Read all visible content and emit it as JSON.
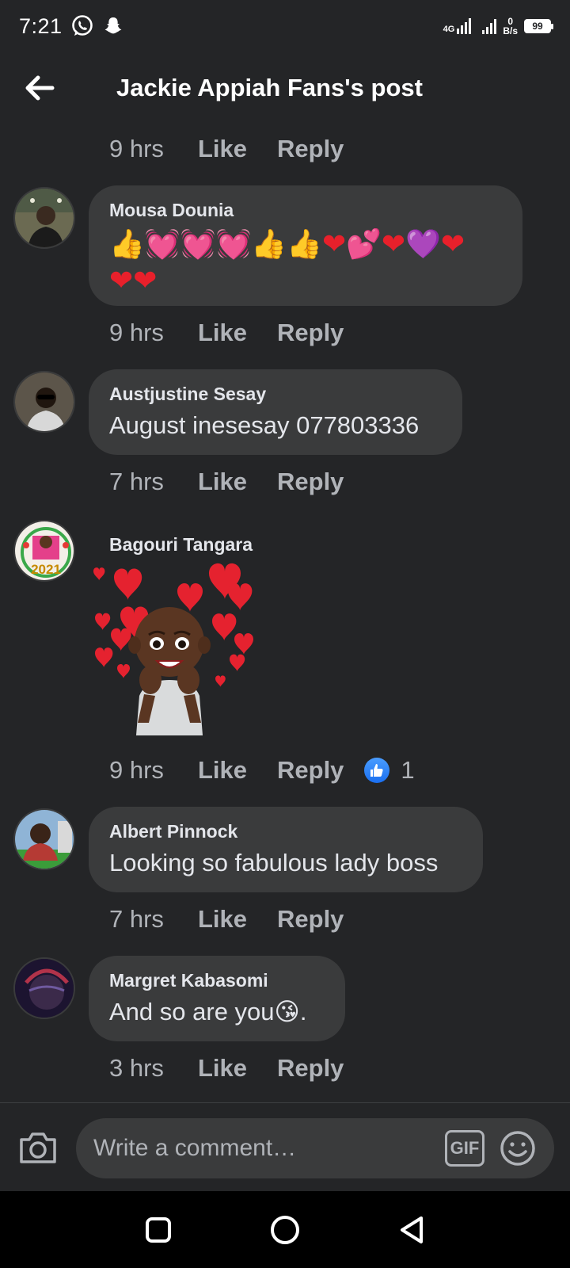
{
  "status_bar": {
    "time": "7:21",
    "network_tag": "4G",
    "speed_value": "0",
    "speed_unit": "B/s",
    "battery": "99"
  },
  "header": {
    "title": "Jackie Appiah Fans's post"
  },
  "actions": {
    "like": "Like",
    "reply": "Reply"
  },
  "top_meta": {
    "time": "9 hrs"
  },
  "comments": [
    {
      "author": "Mousa Dounia",
      "emoji_line_1": "👍💓💓💓👍👍❤💕❤💜❤",
      "emoji_line_2": "❤❤",
      "time": "9 hrs"
    },
    {
      "author": "Austjustine Sesay",
      "text": "August inesesay 077803336",
      "time": "7 hrs"
    },
    {
      "author": "Bagouri Tangara",
      "avatar_text": "2021",
      "sticker": "heart-eyes-avatar-sticker",
      "time": "9 hrs",
      "reaction_count": "1"
    },
    {
      "author": "Albert Pinnock",
      "text": "Looking so fabulous lady boss",
      "time": "7 hrs"
    },
    {
      "author": "Margret Kabasomi",
      "text": "And so are you😘.",
      "time": "3 hrs"
    }
  ],
  "composer": {
    "placeholder": "Write a comment…",
    "gif_label": "GIF"
  },
  "colors": {
    "background": "#242527",
    "bubble": "#3a3b3c",
    "secondary_text": "#b0b3b8",
    "like_blue": "#1a6ff0"
  }
}
